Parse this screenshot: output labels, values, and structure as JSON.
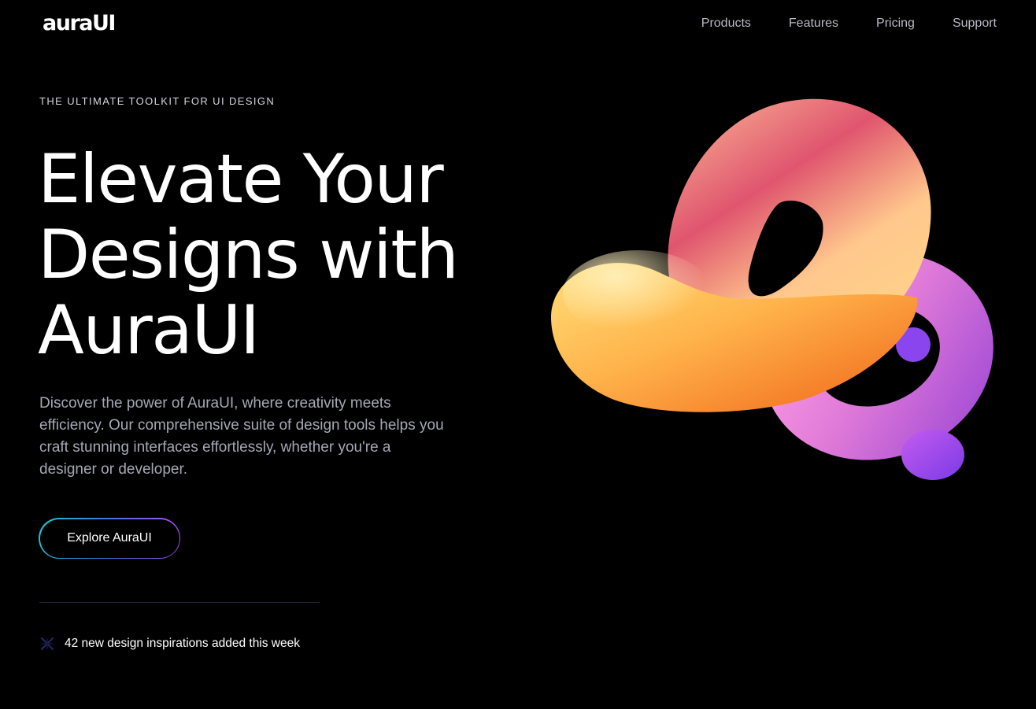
{
  "brand": {
    "logo_text": "auraUI"
  },
  "nav": {
    "items": [
      {
        "label": "Products"
      },
      {
        "label": "Features"
      },
      {
        "label": "Pricing"
      },
      {
        "label": "Support"
      }
    ]
  },
  "hero": {
    "eyebrow": "THE ULTIMATE TOOLKIT FOR UI DESIGN",
    "headline_lines": [
      "Elevate Your",
      "Designs with",
      "AuraUI"
    ],
    "description": "Discover the power of AuraUI, where creativity meets efficiency. Our comprehensive suite of design tools helps you craft stunning interfaces effortlessly, whether you're a designer or developer.",
    "cta_label": "Explore AuraUI"
  },
  "update": {
    "icon": "sparkle-icon",
    "text": "42 new design inspirations added this week"
  },
  "colors": {
    "background": "#000000",
    "nav_text": "#b9bac4",
    "description_text": "#a6a7b5",
    "cta_gradient": [
      "#1cc6cf",
      "#3f72e6",
      "#b64cf2"
    ]
  }
}
